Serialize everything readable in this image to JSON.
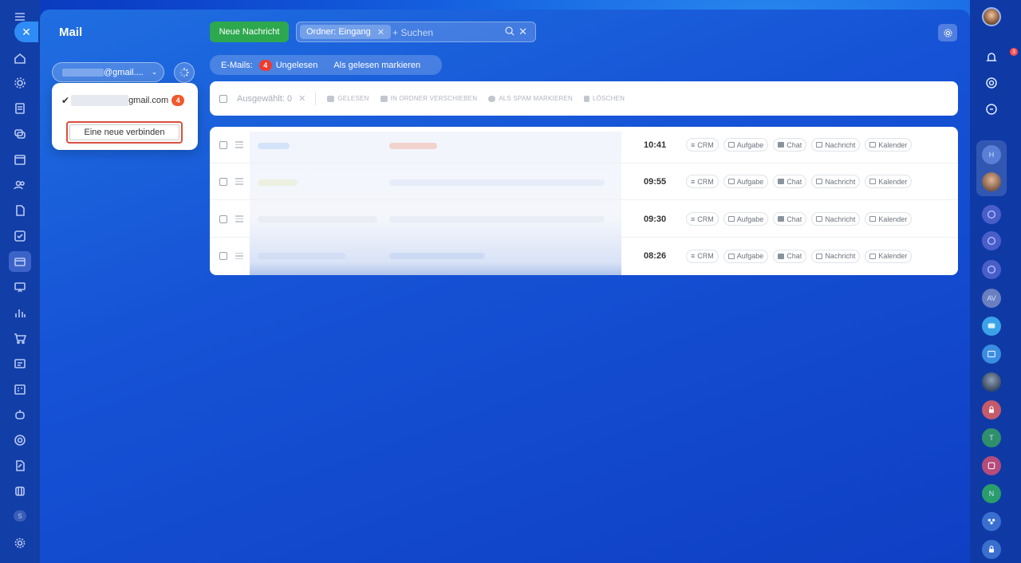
{
  "app": {
    "title": "Mail",
    "close_icon": "close-icon"
  },
  "toolbar_top": {
    "new_message": "Neue Nachricht",
    "folder_chip": "Ordner: Eingang",
    "search_placeholder": "+ Suchen"
  },
  "counter": {
    "label": "E-Mails:",
    "count": "4",
    "unread": "Ungelesen",
    "mark_read": "Als gelesen markieren"
  },
  "account": {
    "selected": "@gmail....",
    "popup_email": "gmail.com",
    "popup_badge": "4",
    "connect_new": "Eine neue verbinden"
  },
  "bulk": {
    "selected": "Ausgewählt: 0",
    "read": "GELESEN",
    "move": "IN ORDNER VERSCHIEBEN",
    "spam": "ALS SPAM MARKIEREN",
    "delete": "LÖSCHEN"
  },
  "actions": [
    "CRM",
    "Aufgabe",
    "Chat",
    "Nachricht",
    "Kalender"
  ],
  "messages": [
    {
      "time": "10:41"
    },
    {
      "time": "09:55"
    },
    {
      "time": "09:30"
    },
    {
      "time": "08:26"
    }
  ],
  "right_rail": {
    "bell_badge": "3",
    "avatar_initials": [
      "H",
      "AV",
      "T",
      "N"
    ]
  },
  "left_rail": {
    "s_badge": "S"
  },
  "colors": {
    "primary_green": "#2ea84f",
    "badge_red": "#ee3b2f",
    "highlight_outline": "#d9503f"
  }
}
